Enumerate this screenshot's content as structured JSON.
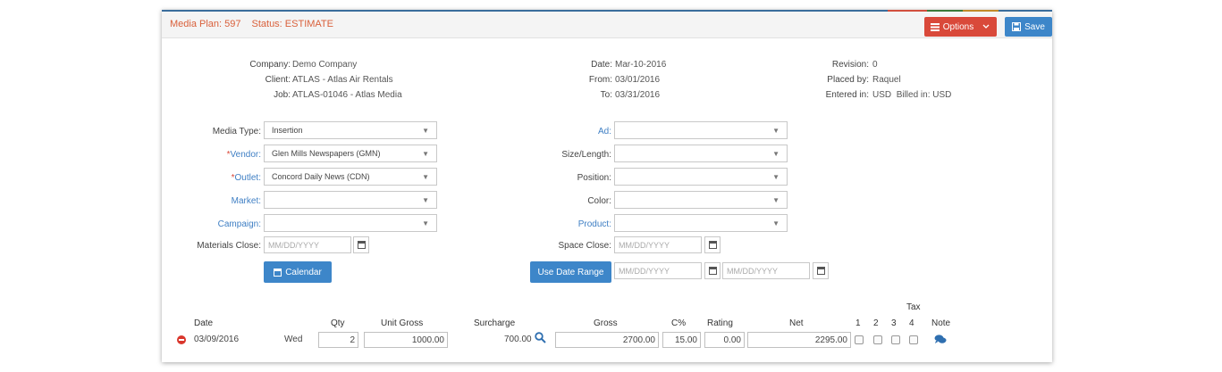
{
  "header": {
    "media_plan": "Media Plan: 597",
    "status": "Status: ESTIMATE",
    "options_label": "Options",
    "save_label": "Save"
  },
  "info": {
    "company_label": "Company:",
    "company": "Demo Company",
    "client_label": "Client:",
    "client": "ATLAS - Atlas Air Rentals",
    "job_label": "Job:",
    "job": "ATLAS-01046 - Atlas Media",
    "date_label": "Date:",
    "date": "Mar-10-2016",
    "from_label": "From:",
    "from": "03/01/2016",
    "to_label": "To:",
    "to": "03/31/2016",
    "revision_label": "Revision:",
    "revision": "0",
    "placed_by_label": "Placed by:",
    "placed_by": "Raquel",
    "entered_in_label": "Entered in:",
    "entered_in": "USD",
    "billed_in_label": "Billed in:",
    "billed_in": "USD"
  },
  "form": {
    "media_type_label": "Media Type:",
    "media_type": "Insertion",
    "vendor_label": "Vendor:",
    "vendor": "Glen Mills Newspapers (GMN)",
    "outlet_label": "Outlet:",
    "outlet": "Concord Daily News (CDN)",
    "market_label": "Market:",
    "market": "",
    "campaign_label": "Campaign:",
    "campaign": "",
    "materials_close_label": "Materials Close:",
    "ad_label": "Ad:",
    "ad": "",
    "size_length_label": "Size/Length:",
    "size_length": "",
    "position_label": "Position:",
    "position": "",
    "color_label": "Color:",
    "color": "",
    "product_label": "Product:",
    "product": "",
    "space_close_label": "Space Close:",
    "date_placeholder": "MM/DD/YYYY",
    "required_mark": "*",
    "calendar_button": "Calendar",
    "date_range_button": "Use Date Range"
  },
  "table": {
    "tax_group": "Tax",
    "headers": {
      "date": "Date",
      "qty": "Qty",
      "unit_gross": "Unit Gross",
      "surcharge": "Surcharge",
      "gross": "Gross",
      "c_pct": "C%",
      "rating": "Rating",
      "net": "Net",
      "tax1": "1",
      "tax2": "2",
      "tax3": "3",
      "tax4": "4",
      "note": "Note"
    },
    "row": {
      "date": "03/09/2016",
      "day": "Wed",
      "qty": "2",
      "unit_gross": "1000.00",
      "surcharge": "700.00",
      "gross": "2700.00",
      "c_pct": "15.00",
      "rating": "0.00",
      "net": "2295.00"
    }
  },
  "colors": {
    "accent_orange": "#d9603b",
    "options_red": "#d9493a",
    "primary_blue": "#3d86c9",
    "link_blue": "#3f7fc4"
  },
  "icons": [
    "list-icon",
    "chevron-down-icon",
    "save-icon",
    "calendar-icon",
    "search-icon",
    "remove-icon",
    "comment-icon"
  ]
}
